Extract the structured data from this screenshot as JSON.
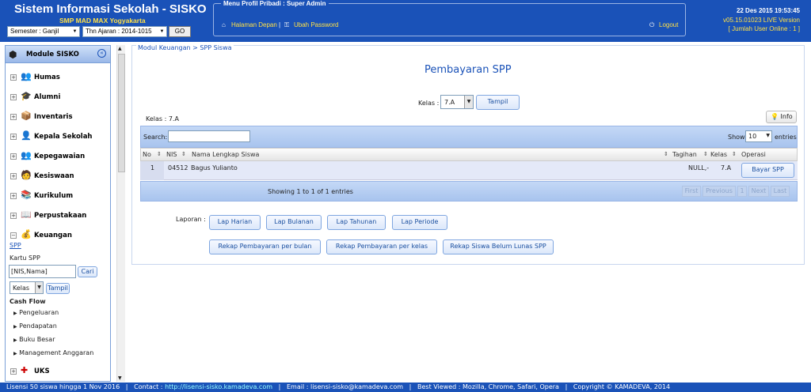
{
  "header": {
    "title": "Sistem Informasi Sekolah - SISKO",
    "school": "SMP MAD MAX Yogyakarta",
    "semester": "Semester : Ganjil",
    "year": "Thn Ajaran : 2014-1015",
    "go": "GO",
    "menu_label": "Menu Profil Pribadi : Super Admin",
    "home": "Halaman Depan",
    "sep": "|",
    "change_password": "Ubah Password",
    "logout": "Logout",
    "datetime": "22 Des 2015 19:53:45",
    "version": "v05.15.01023 LIVE Version",
    "online": "[ Jumlah User Online : 1 ]"
  },
  "sidebar": {
    "title": "Module SISKO",
    "modules": [
      {
        "label": "Humas",
        "icon": "👥"
      },
      {
        "label": "Alumni",
        "icon": "🎓"
      },
      {
        "label": "Inventaris",
        "icon": "📦"
      },
      {
        "label": "Kepala Sekolah",
        "icon": "👤"
      },
      {
        "label": "Kepegawaian",
        "icon": "👥"
      },
      {
        "label": "Kesiswaan",
        "icon": "🧑"
      },
      {
        "label": "Kurikulum",
        "icon": "📚"
      },
      {
        "label": "Perpustakaan",
        "icon": "📖"
      },
      {
        "label": "Keuangan",
        "icon": "💰"
      }
    ],
    "spp": "SPP",
    "kartu": "Kartu SPP",
    "nis_value": "[NIS,Nama]",
    "cari": "Cari",
    "kelas": "Kelas",
    "tampil": "Tampil",
    "cashflow": "Cash Flow",
    "cash_items": [
      "Pengeluaran",
      "Pendapatan",
      "Buku Besar",
      "Management Anggaran"
    ],
    "uks": "UKS"
  },
  "main": {
    "breadcrumb": "Modul Keuangan > SPP Siswa",
    "heading": "Pembayaran SPP",
    "kelas_label": "Kelas :",
    "kelas_value": "7.A",
    "tampil": "Tampil",
    "kelas_info": "Kelas : 7.A",
    "info": "Info",
    "search_label": "Search:",
    "show": "Show",
    "show_value": "10",
    "entries": "entries",
    "columns": [
      "No",
      "NIS",
      "Nama Lengkap Siswa",
      "Tagihan",
      "Kelas",
      "Operasi"
    ],
    "rows": [
      {
        "no": "1",
        "nis": "04512",
        "nama": "Bagus Yulianto",
        "tagihan": "NULL,-",
        "kelas": "7.A",
        "op": "Bayar SPP"
      }
    ],
    "showing": "Showing 1 to 1 of 1 entries",
    "pager": [
      "First",
      "Previous",
      "1",
      "Next",
      "Last"
    ],
    "laporan": "Laporan :",
    "lap_buttons": [
      "Lap Harian",
      "Lap Bulanan",
      "Lap Tahunan",
      "Lap Periode"
    ],
    "rekap_buttons": [
      "Rekap Pembayaran per bulan",
      "Rekap Pembayaran per kelas",
      "Rekap Siswa Belum Lunas SPP"
    ]
  },
  "footer": {
    "license": "Lisensi 50 siswa hingga 1 Nov 2016",
    "contact": "Contact :",
    "contact_url": "http://lisensi-sisko.kamadeva.com",
    "email": "Email : lisensi-sisko@kamadeva.com",
    "browser": "Best Viewed : Mozilla, Chrome, Safari, Opera",
    "copyright": "Copyright © KAMADEVA, 2014",
    "sep": "|"
  }
}
